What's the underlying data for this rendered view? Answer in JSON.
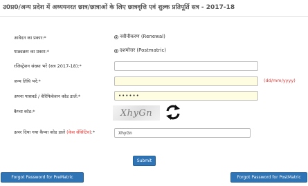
{
  "header": {
    "title": "उ0प्र0/अन्य प्रदेश में अध्ययनरत छात्र/छात्राओं के लिए छात्रवृत्ति एवं शुल्क प्रतिपूर्ति सत्र - 2017-18"
  },
  "form": {
    "application_type_label": "आवेदन का प्रकार:*",
    "application_type_value": "नवीनीकरण (Renewal)",
    "course_type_label": "पाठ्यक्रम का प्रकार:*",
    "course_type_value": "दशमोत्तर (Postmatric)",
    "registration_label": "रजिस्ट्रेशन संख्या भरें (सत्र 2017-18):*",
    "registration_value": "",
    "dob_label": "जन्म तिथि भरें:*",
    "dob_value": "",
    "dob_hint": "(dd/mm/yyyy)",
    "password_label": "अपना पासवर्ड / वेरिफिकेशन कोड डालें:*",
    "password_value": "••••••",
    "captcha_label": "कैप्चा कोड:*",
    "captcha_text": "XhyGn",
    "captcha_input_label": "ऊपर दिया गया कैप्चा कोड डालें",
    "captcha_input_note": "(केस सेंसिटिव)",
    "captcha_input_suffix": ":*",
    "captcha_input_value": "XhyGn"
  },
  "buttons": {
    "submit": "Submit",
    "forgot_prematric": "Forgot Password for PreMatric",
    "forgot_postmatric": "Forgot Password for PostMatric"
  },
  "icons": {
    "refresh": "refresh-icon"
  },
  "colors": {
    "button": "#2f74b5",
    "required_note": "#e53935",
    "highlight_field": "#fffde1"
  }
}
